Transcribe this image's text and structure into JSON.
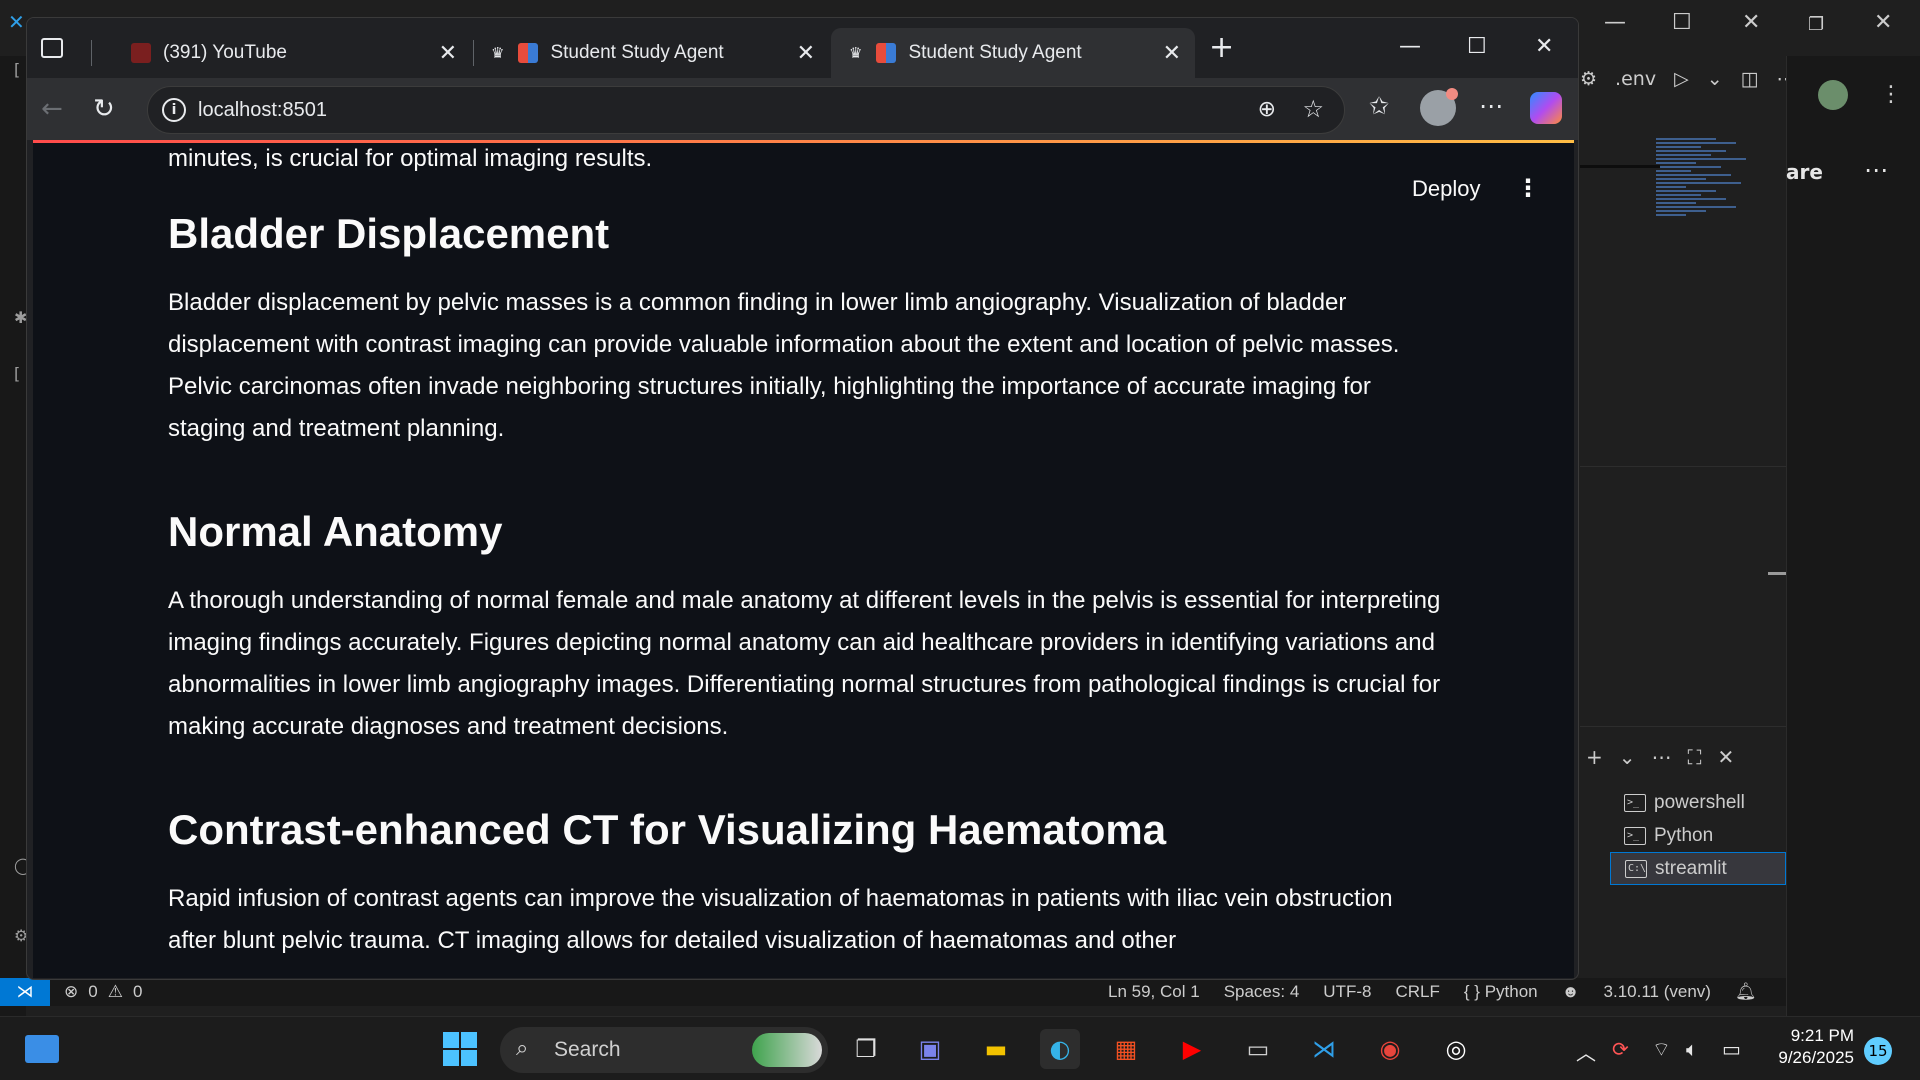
{
  "browser": {
    "tabs": [
      {
        "label": "(391) YouTube",
        "favicon_color": "#cc0000"
      },
      {
        "label": "Student Study Agent",
        "favicon_color": "#e74c3c"
      },
      {
        "label": "Student Study Agent",
        "favicon_color": "#e74c3c",
        "active": true
      }
    ],
    "url": "localhost:8501"
  },
  "streamlit": {
    "deploy_label": "Deploy",
    "top_text": "minutes, is crucial for optimal imaging results.",
    "sections": [
      {
        "heading": "Bladder Displacement",
        "body": "Bladder displacement by pelvic masses is a common finding in lower limb angiography. Visualization of bladder displacement with contrast imaging can provide valuable information about the extent and location of pelvic masses. Pelvic carcinomas often invade neighboring structures initially, highlighting the importance of accurate imaging for staging and treatment planning."
      },
      {
        "heading": "Normal Anatomy",
        "body": "A thorough understanding of normal female and male anatomy at different levels in the pelvis is essential for interpreting imaging findings accurately. Figures depicting normal anatomy can aid healthcare providers in identifying variations and abnormalities in lower limb angiography images. Differentiating normal structures from pathological findings is crucial for making accurate diagnoses and treatment decisions."
      },
      {
        "heading": "Contrast-enhanced CT for Visualizing Haematoma",
        "body": "Rapid infusion of contrast agents can improve the visualization of haematomas in patients with iliac vein obstruction after blunt pelvic trauma. CT imaging allows for detailed visualization of haematomas and other"
      }
    ]
  },
  "vscode": {
    "toolbar_env": ".env",
    "share_label": "are",
    "terminals": [
      {
        "label": "powershell",
        "active": false
      },
      {
        "label": "Python",
        "active": false
      },
      {
        "label": "streamlit",
        "active": true
      }
    ],
    "status": {
      "errors": "0",
      "warnings": "0",
      "position": "Ln 59, Col 1",
      "spaces": "Spaces: 4",
      "encoding": "UTF-8",
      "eol": "CRLF",
      "language": "Python",
      "interpreter": "3.10.11 (venv)"
    }
  },
  "taskbar": {
    "search_label": "Search",
    "time": "9:21 PM",
    "date": "9/26/2025",
    "notification_count": "15"
  }
}
